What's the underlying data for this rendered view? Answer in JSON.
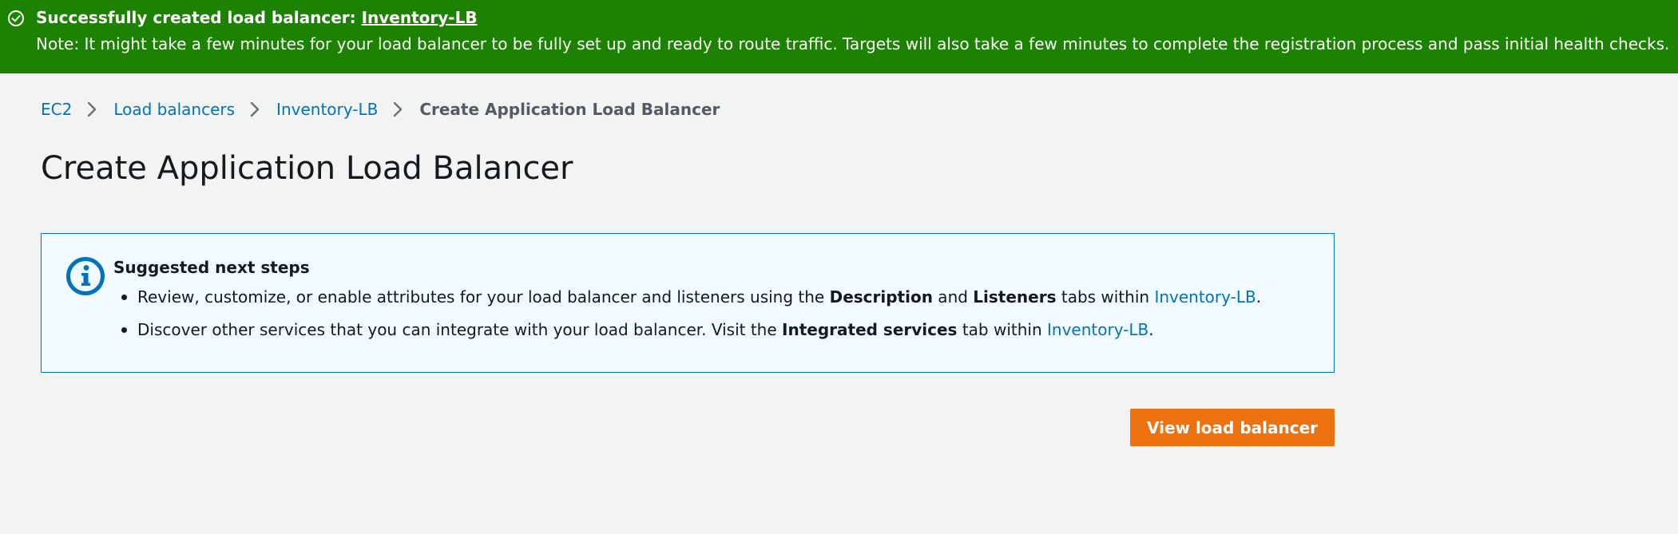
{
  "banner": {
    "icon": "check-circle-icon",
    "title_prefix": "Successfully created load balancer: ",
    "title_link": "Inventory-LB",
    "note": "Note: It might take a few minutes for your load balancer to be fully set up and ready to route traffic. Targets will also take a few minutes to complete the registration process and pass initial health checks.",
    "color": "#1d8102"
  },
  "breadcrumb": {
    "items": [
      "EC2",
      "Load balancers",
      "Inventory-LB"
    ],
    "current": "Create Application Load Balancer",
    "separator_icon": "chevron-right-icon"
  },
  "page": {
    "title": "Create Application Load Balancer"
  },
  "info": {
    "icon": "info-icon",
    "heading": "Suggested next steps",
    "bullet1": {
      "before": "Review, customize, or enable attributes for your load balancer and listeners using the ",
      "bold1": "Description",
      "middle": " and ",
      "bold2": "Listeners",
      "after": " tabs within ",
      "link": "Inventory-LB",
      "end": "."
    },
    "bullet2": {
      "before": "Discover other services that you can integrate with your load balancer. Visit the ",
      "bold": "Integrated services",
      "after": " tab within ",
      "link": "Inventory-LB",
      "end": "."
    }
  },
  "actions": {
    "view_button": "View load balancer",
    "button_color": "#ec7211"
  }
}
